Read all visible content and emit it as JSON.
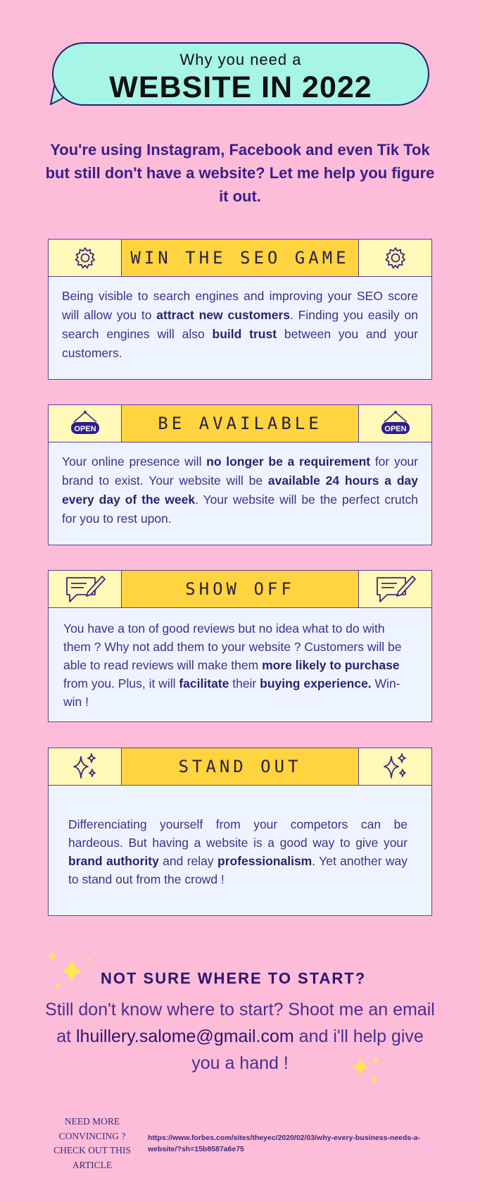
{
  "header": {
    "subtitle": "Why you need a",
    "title": "WEBSITE IN 2022"
  },
  "intro": "You're using Instagram, Facebook and even Tik Tok but still don't have a website? Let me help you figure it out.",
  "cards": [
    {
      "title": "WIN THE SEO GAME",
      "icon": "gear-icon",
      "parts": [
        "Being visible to search engines and improving your SEO score will allow you to ",
        "attract new customers",
        ". Finding you easily on search engines will also ",
        "build trust",
        " between you and your customers."
      ]
    },
    {
      "title": "BE AVAILABLE",
      "icon": "open-sign-icon",
      "icon_text": "OPEN",
      "parts": [
        "Your online presence will ",
        "no longer be a requirement",
        " for your brand to exist. Your website will be ",
        "available 24 hours a day every day of the week",
        ". Your website will be the perfect crutch for you to rest upon."
      ]
    },
    {
      "title": "SHOW OFF",
      "icon": "chat-pencil-icon",
      "parts": [
        "You have a ton of good reviews but no idea what to do with them ? Why not add them to your website ? Customers will be able to read reviews will make them ",
        "more likely to purchase",
        " from you. Plus, it will ",
        "facilitate",
        " their ",
        "buying experience.",
        " Win-win !"
      ]
    },
    {
      "title": "STAND OUT",
      "icon": "sparkles-icon",
      "parts": [
        "Differenciating yourself from your competors can be hardeous. But having a website is a good way to give your ",
        "brand authority",
        " and relay ",
        "professionalism",
        ". Yet another way to stand out from the crowd !"
      ]
    }
  ],
  "cta": {
    "title": "NOT SURE WHERE TO START?",
    "text_before": "Still don't know where to start? Shoot me an email at ",
    "email": "lhuillery.salome@gmail.com",
    "text_after": " and i'll help give you a hand !"
  },
  "footer": {
    "more": "NEED MORE CONVINCING ? CHECK OUT THIS ARTICLE",
    "link": "https://www.forbes.com/sites/theyec/2020/02/03/why-every-business-needs-a-website/?sh=15b8587a6e75"
  },
  "colors": {
    "background": "#fdbdd8",
    "bubble": "#a6f5e6",
    "title_bar": "#ffd43f",
    "icon_cell": "#fff8b8",
    "card_body": "#eef4ff",
    "accent": "#3b2a7a",
    "sparkle": "#ffe94a"
  }
}
